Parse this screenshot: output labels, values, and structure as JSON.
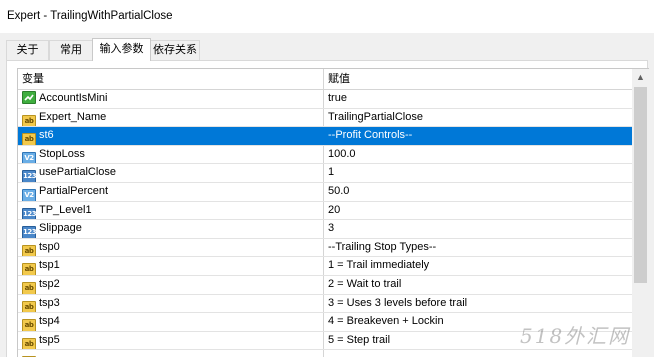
{
  "window": {
    "title": "Expert - TrailingWithPartialClose"
  },
  "tabs": [
    {
      "label": "关于",
      "active": false
    },
    {
      "label": "常用",
      "active": false
    },
    {
      "label": "输入参数",
      "active": true
    },
    {
      "label": "依存关系",
      "active": false
    }
  ],
  "grid": {
    "headers": {
      "variable": "变量",
      "value": "赋值"
    },
    "rows": [
      {
        "type": "bool",
        "icon": "bool-icon",
        "name": "AccountIsMini",
        "value": "true"
      },
      {
        "type": "str",
        "icon": "string-icon",
        "name": "Expert_Name",
        "value": "TrailingPartialClose"
      },
      {
        "type": "str",
        "icon": "string-icon",
        "name": "st6",
        "value": "--Profit Controls--",
        "selected": true
      },
      {
        "type": "dbl",
        "icon": "double-icon",
        "name": "StopLoss",
        "value": "100.0"
      },
      {
        "type": "int",
        "icon": "integer-icon",
        "name": "usePartialClose",
        "value": "1"
      },
      {
        "type": "dbl",
        "icon": "double-icon",
        "name": "PartialPercent",
        "value": "50.0"
      },
      {
        "type": "int",
        "icon": "integer-icon",
        "name": "TP_Level1",
        "value": "20"
      },
      {
        "type": "int",
        "icon": "integer-icon",
        "name": "Slippage",
        "value": "3"
      },
      {
        "type": "str",
        "icon": "string-icon",
        "name": "tsp0",
        "value": "--Trailing Stop Types--"
      },
      {
        "type": "str",
        "icon": "string-icon",
        "name": "tsp1",
        "value": " 1 = Trail immediately"
      },
      {
        "type": "str",
        "icon": "string-icon",
        "name": "tsp2",
        "value": " 2 = Wait to trail"
      },
      {
        "type": "str",
        "icon": "string-icon",
        "name": "tsp3",
        "value": " 3 = Uses 3 levels before trail"
      },
      {
        "type": "str",
        "icon": "string-icon",
        "name": "tsp4",
        "value": " 4 = Breakeven + Lockin"
      },
      {
        "type": "str",
        "icon": "string-icon",
        "name": "tsp5",
        "value": " 5 = Step trail"
      },
      {
        "type": "str",
        "icon": "string-icon",
        "name": "",
        "value": ""
      }
    ]
  },
  "icon_text": {
    "str": "ab",
    "dbl": "V2",
    "int": "123"
  },
  "watermark": "518外汇网",
  "colors": {
    "selection": "#0078d7"
  }
}
